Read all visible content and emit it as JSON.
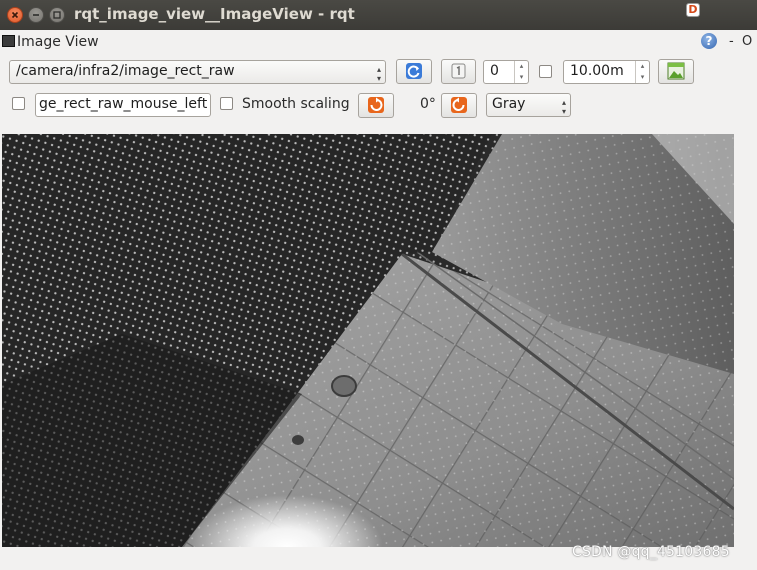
{
  "window": {
    "title": "rqt_image_view__ImageView - rqt"
  },
  "dock": {
    "title": "Image View",
    "d_label": "D",
    "help_label": "?",
    "close_label": "-",
    "float_label": "O"
  },
  "toolbar": {
    "topic": "/camera/infra2/image_rect_raw",
    "spin_value": "0",
    "max_range": "10.00m",
    "mouse_topic": "ge_rect_raw_mouse_left",
    "smooth_scaling_label": "Smooth scaling",
    "rotation": "0°",
    "color_scheme": "Gray"
  },
  "watermark": "CSDN @qq_45103685",
  "colors": {
    "refresh_blue": "#3b7bd8",
    "rotate_orange": "#e8661c",
    "save_green": "#5aa02c"
  }
}
